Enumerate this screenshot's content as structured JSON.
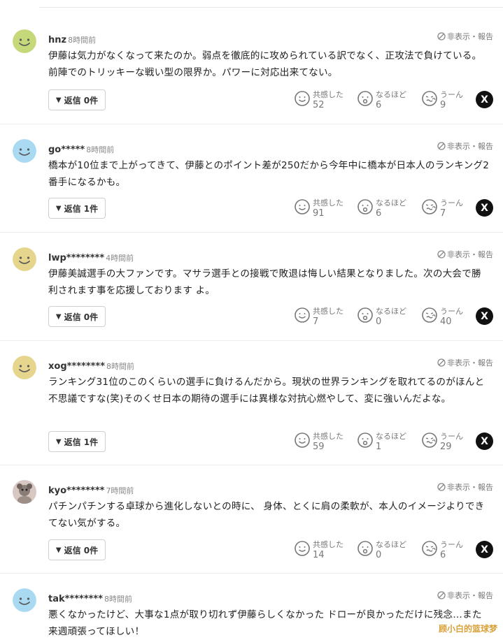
{
  "common": {
    "hide_report": "非表示・報告",
    "reaction_labels": [
      "共感した",
      "なるほど",
      "うーん"
    ],
    "x_label": "X"
  },
  "comments": [
    {
      "user": "hnz",
      "time": "8時間前",
      "avatar": {
        "type": "smile",
        "color": "#c5d97a"
      },
      "body": "伊藤は気力がなくなって来たのか。弱点を徹底的に攻められている訳でなく、正攻法で負けている。 前陣でのトリッキーな戦い型の限界か。パワーに対応出来てない。",
      "reply": "返信 0件",
      "counts": [
        "52",
        "6",
        "9"
      ]
    },
    {
      "user": "go*****",
      "time": "8時間前",
      "avatar": {
        "type": "smile",
        "color": "#a9daf2"
      },
      "body": "橋本が10位まで上がってきて、伊藤とのポイント差が250だから今年中に橋本が日本人のランキング2番手になるかも。",
      "reply": "返信 1件",
      "counts": [
        "91",
        "6",
        "7"
      ]
    },
    {
      "user": "lwp********",
      "time": "4時間前",
      "avatar": {
        "type": "smile",
        "color": "#e6d58c"
      },
      "body": "伊藤美誠選手の大ファンです。マサラ選手との接戦で敗退は悔しい結果となりました。次の大会で勝利されます事を応援しております よ。",
      "reply": "返信 0件",
      "counts": [
        "7",
        "0",
        "40"
      ]
    },
    {
      "user": "xog********",
      "time": "8時間前",
      "avatar": {
        "type": "smile",
        "color": "#e6d58c"
      },
      "body": "ランキング31位のこのくらいの選手に負けるんだから。現状の世界ランキングを取れてるのがほんと不思議ですな(笑)そのくせ日本の期待の選手には異様な対抗心燃やして、変に強いんだよな。",
      "reply": "返信 1件",
      "counts": [
        "59",
        "1",
        "29"
      ]
    },
    {
      "user": "kyo********",
      "time": "7時間前",
      "avatar": {
        "type": "photo",
        "color": "#d8c7c2"
      },
      "body": "パチンパチンする卓球から進化しないとの時に、 身体、とくに肩の柔軟が、本人のイメージよりできてない気がする。",
      "reply": "返信 0件",
      "counts": [
        "14",
        "0",
        "6"
      ]
    },
    {
      "user": "tak********",
      "time": "8時間前",
      "avatar": {
        "type": "smile",
        "color": "#a9daf2"
      },
      "body": "悪くなかったけど、大事な1点が取り切れず伊藤らしくなかった ドローが良かっただけに残念…また来週頑張ってほしい！",
      "reply": "",
      "counts": []
    }
  ],
  "watermark": "顾小白的篮球梦"
}
